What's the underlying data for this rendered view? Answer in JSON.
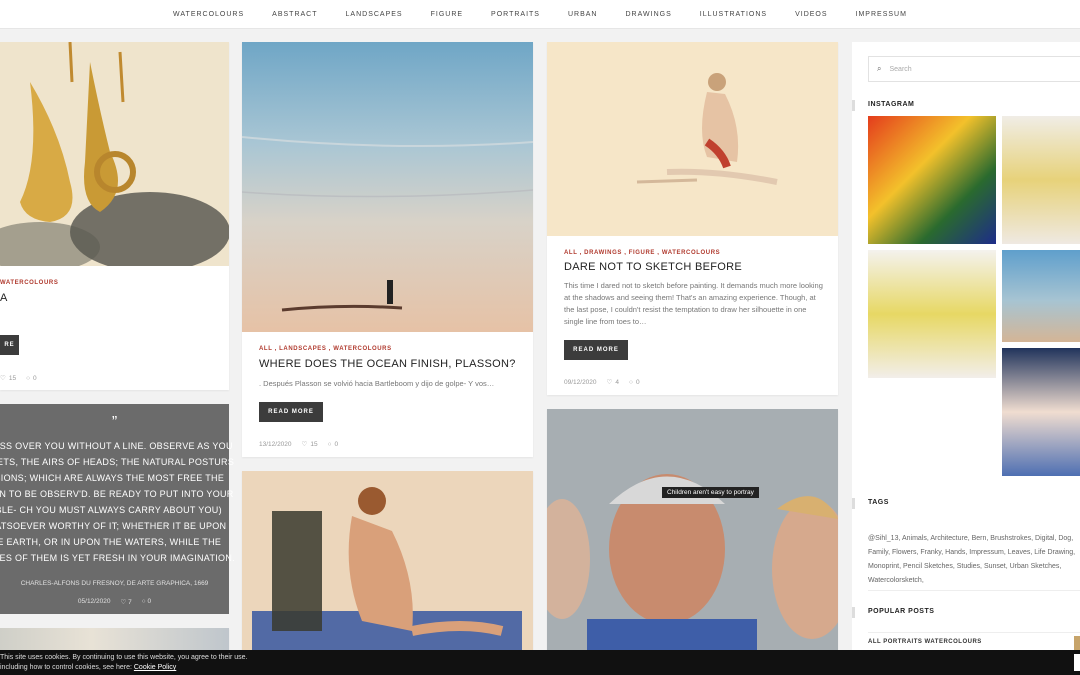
{
  "nav": [
    "WATERCOLOURS",
    "ABSTRACT",
    "LANDSCAPES",
    "FIGURE",
    "PORTRAITS",
    "URBAN",
    "DRAWINGS",
    "ILLUSTRATIONS",
    "VIDEOS",
    "IMPRESSUM"
  ],
  "col1": {
    "card1": {
      "cats": "WATERCOLOURS",
      "title": "A",
      "btn": "RE",
      "likes": "15",
      "comments": "0"
    },
    "quote": {
      "mark": "”",
      "text": "AY PASS OVER YOU WITHOUT A LINE. OBSERVE AS YOU STREETS, THE AIRS OF HEADS; THE NATURAL POSTURS ESSIONS; WHICH ARE ALWAYS THE MOST FREE THE LESS N TO BE OBSERV'D. BE READY TO PUT INTO YOUR TABLE- CH YOU MUST ALWAYS CARRY ABOUT YOU) WHATSOEVER WORTHY OF IT; WHETHER IT BE UPON THE EARTH, OR IN UPON THE WATERS, WHILE THE SPECIES OF THEM IS YET FRESH IN YOUR IMAGINATION.",
      "author": "CHARLES-ALFONS DU FRESNOY, DE ARTE GRAPHICA, 1669",
      "date": "05/12/2020",
      "likes": "7",
      "comments": "0"
    }
  },
  "col2": {
    "card1": {
      "cats": "ALL , LANDSCAPES , WATERCOLOURS",
      "title": "WHERE DOES THE OCEAN FINISH, PLASSON?",
      "excerpt": ". Después Plasson se volvió hacia Bartleboom y dijo de golpe- Y vos…",
      "btn": "READ MORE",
      "date": "13/12/2020",
      "likes": "15",
      "comments": "0"
    }
  },
  "col3": {
    "card1": {
      "cats": "ALL , DRAWINGS , FIGURE , WATERCOLOURS",
      "title": "DARE NOT TO SKETCH BEFORE",
      "excerpt": "This time I dared not to sketch before painting. It demands much more looking at the shadows and seeing them! That's an amazing experience. Though, at the last pose, I couldn't resist the temptation to draw her silhouette in one single line from toes to…",
      "btn": "READ MORE",
      "date": "09/12/2020",
      "likes": "4",
      "comments": "0"
    },
    "card2": {
      "tooltip": "Children aren't easy to portray"
    }
  },
  "sidebar": {
    "search_placeholder": "Search",
    "instagram": "INSTAGRAM",
    "tags_title": "TAGS",
    "tags": "@Sihl_13, Animals, Architecture, Bern, Brushstrokes, Digital, Dog, Family, Flowers, Franky, Hands, Impressum, Leaves, Life Drawing, Monoprint, Pencil Sketches, Studies, Sunset, Urban Sketches, Watercolorsketch,",
    "popular_title": "POPULAR POSTS",
    "popular_first": "ALL PORTRAITS WATERCOLOURS"
  },
  "cookie": {
    "line1": "This site uses cookies. By continuing to use this website, you agree to their use.",
    "line2": "including how to control cookies, see here:",
    "link": "Cookie Policy"
  },
  "colors": {
    "accent": "#b03a2e",
    "button": "#3c3c3c",
    "quote_bg": "#6b6b6b"
  }
}
